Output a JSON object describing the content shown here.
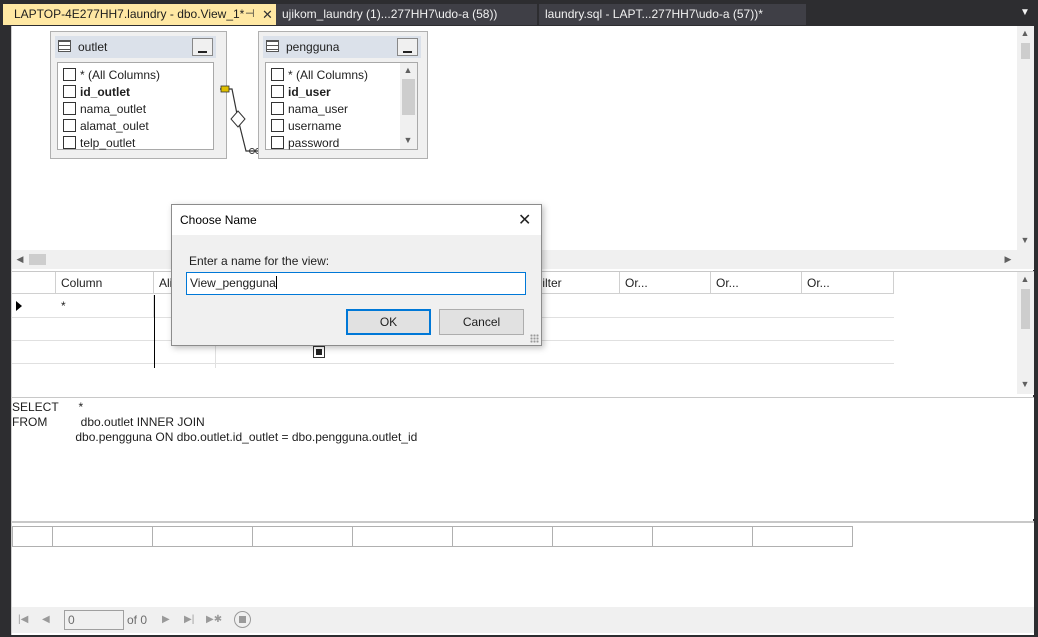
{
  "tabs": [
    {
      "label": "LAPTOP-4E277HH7.laundry - dbo.View_1*",
      "active": true
    },
    {
      "label": "ujikom_laundry (1)...277HH7\\udo-a (58))",
      "active": false
    },
    {
      "label": "laundry.sql - LAPT...277HH7\\udo-a (57))*",
      "active": false
    }
  ],
  "diagram": {
    "tables": [
      {
        "name": "outlet",
        "columns": [
          {
            "label": "* (All Columns)",
            "key": false
          },
          {
            "label": "id_outlet",
            "key": true
          },
          {
            "label": "nama_outlet",
            "key": false
          },
          {
            "label": "alamat_oulet",
            "key": false
          },
          {
            "label": "telp_outlet",
            "key": false
          }
        ]
      },
      {
        "name": "pengguna",
        "columns": [
          {
            "label": "* (All Columns)",
            "key": false
          },
          {
            "label": "id_user",
            "key": true
          },
          {
            "label": "nama_user",
            "key": false
          },
          {
            "label": "username",
            "key": false
          },
          {
            "label": "password",
            "key": false
          }
        ]
      }
    ]
  },
  "criteria_grid": {
    "headers": [
      "Column",
      "Ali",
      "Filter",
      "Or...",
      "Or...",
      "Or..."
    ],
    "rows": [
      {
        "column": "*"
      }
    ]
  },
  "sql": {
    "lines": [
      "SELECT      *",
      "FROM          dbo.outlet INNER JOIN",
      "                   dbo.pengguna ON dbo.outlet.id_outlet = dbo.pengguna.outlet_id"
    ]
  },
  "results_nav": {
    "current_record": "0",
    "of_label": "of 0"
  },
  "dialog": {
    "title": "Choose Name",
    "prompt": "Enter a name for the view:",
    "value": "View_pengguna",
    "ok_label": "OK",
    "cancel_label": "Cancel"
  },
  "colors": {
    "active_tab": "#ffe8a3",
    "chrome": "#2d2d30",
    "accent": "#0078d7"
  }
}
